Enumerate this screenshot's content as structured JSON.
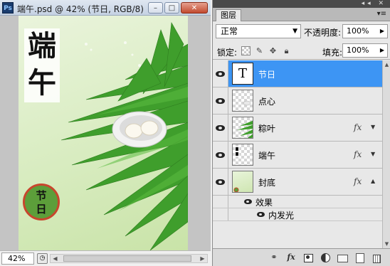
{
  "document": {
    "app_badge": "Ps",
    "title": "端午.psd @ 42% (节日, RGB/8)",
    "window_buttons": {
      "minimize": "–",
      "maximize": "□",
      "close": "✕"
    },
    "artwork": {
      "heading_chars": [
        "端",
        "午"
      ],
      "stamp_chars": [
        "节",
        "日"
      ]
    },
    "status": {
      "zoom": "42%"
    }
  },
  "panel": {
    "tab_label": "图层",
    "blend_mode": "正常",
    "opacity_label": "不透明度:",
    "opacity_value": "100%",
    "lock_label": "锁定:",
    "fill_label": "填充:",
    "fill_value": "100%",
    "layers": [
      {
        "name": "节日",
        "thumb": "T",
        "selected": true,
        "fx": false
      },
      {
        "name": "点心",
        "selected": false,
        "fx": false
      },
      {
        "name": "粽叶",
        "selected": false,
        "fx": true
      },
      {
        "name": "端午",
        "selected": false,
        "fx": true
      },
      {
        "name": "封底",
        "selected": false,
        "fx": true
      }
    ],
    "effects_label": "效果",
    "effect_item": "内发光",
    "fx_symbol": "fx",
    "footer_icons": [
      "link-icon",
      "fx-icon",
      "mask-icon",
      "adjustment-icon",
      "group-folder-icon",
      "new-layer-icon",
      "trash-icon"
    ]
  },
  "colors": {
    "selection": "#3d95f4",
    "leaf": "#3a9a2a",
    "stamp_ring": "#c8462d",
    "stamp_fill": "#5c9e3a"
  }
}
